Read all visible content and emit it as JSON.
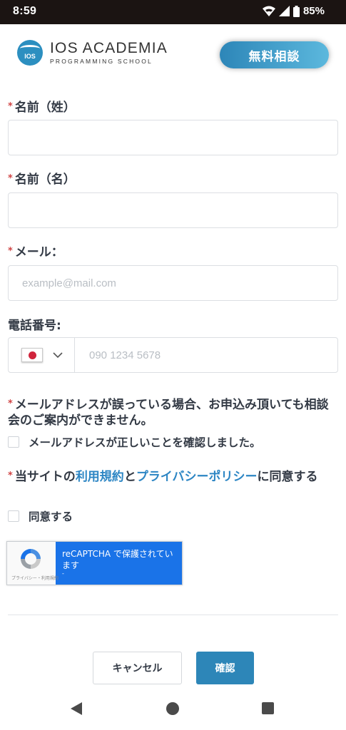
{
  "status_bar": {
    "time": "8:59",
    "battery": "85%",
    "icons": [
      "wifi-icon",
      "signal-icon",
      "battery-icon"
    ]
  },
  "header": {
    "logo_mark": "IOS",
    "logo_title": "IOS ACADEMIA",
    "logo_subtitle": "PROGRAMMING SCHOOL",
    "consult_button": "無料相談"
  },
  "form": {
    "required_mark": "*",
    "last_name": {
      "label": "名前（姓）",
      "value": ""
    },
    "first_name": {
      "label": "名前（名）",
      "value": ""
    },
    "email": {
      "label": "メール：",
      "placeholder": "example@mail.com"
    },
    "phone": {
      "label": "電話番号:",
      "country": "JP",
      "placeholder": "090 1234 5678"
    },
    "email_notice": "メールアドレスが誤っている場合、お申込み頂いても相談会のご案内ができません。",
    "email_confirm_checkbox": "メールアドレスが正しいことを確認しました。",
    "terms": {
      "prefix": "当サイトの",
      "terms_link": "利用規約",
      "and": "と",
      "privacy_link": "プライバシーポリシー",
      "suffix": "に同意する"
    },
    "agree_checkbox": "同意する"
  },
  "recaptcha": {
    "text": "reCAPTCHA で保護されています",
    "dot": "-",
    "footer": "プライバシー・利用規約"
  },
  "actions": {
    "cancel": "キャンセル",
    "confirm": "確認"
  },
  "colors": {
    "accent": "#2d86b8",
    "link": "#2d86c4",
    "required": "#d04545",
    "recaptcha_blue": "#1a73e8"
  }
}
